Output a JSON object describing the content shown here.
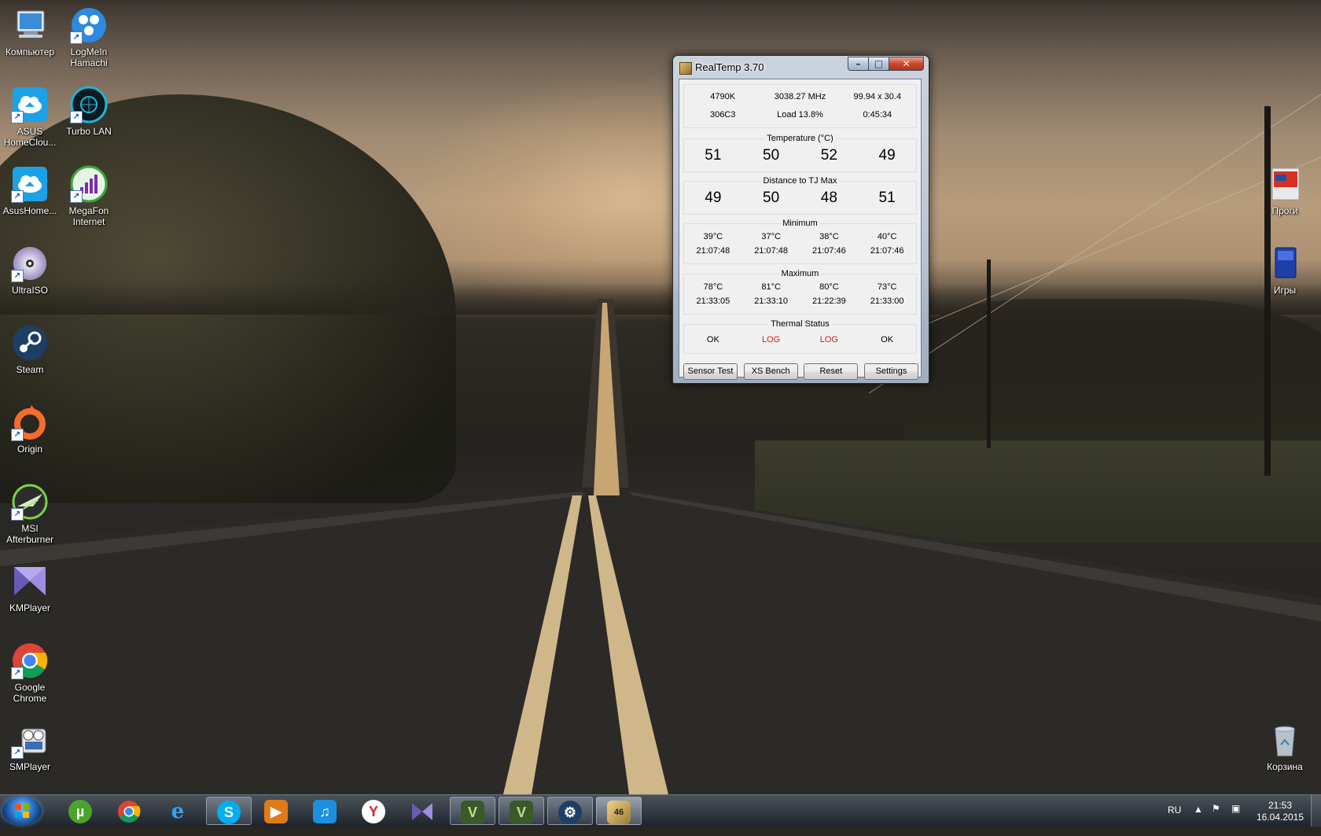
{
  "desktop": {
    "icons_left": [
      {
        "id": "computer",
        "label": "Компьютер",
        "icon": "computer-icon"
      },
      {
        "id": "logmein-hamachi",
        "label": "LogMeIn Hamachi",
        "icon": "hamachi-icon"
      },
      {
        "id": "asus-homecloud",
        "label": "ASUS HomeClou...",
        "icon": "homecloud-icon"
      },
      {
        "id": "turbo-lan",
        "label": "Turbo LAN",
        "icon": "turbo-lan-icon"
      },
      {
        "id": "asushome",
        "label": "AsusHome...",
        "icon": "homecloud-icon"
      },
      {
        "id": "megafon-internet",
        "label": "MegaFon Internet",
        "icon": "megafon-icon"
      },
      {
        "id": "ultraiso",
        "label": "UltraISO",
        "icon": "disc-icon"
      },
      {
        "id": "steam",
        "label": "Steam",
        "icon": "steam-icon"
      },
      {
        "id": "origin",
        "label": "Origin",
        "icon": "origin-icon"
      },
      {
        "id": "msi-afterburner",
        "label": "MSI Afterburner",
        "icon": "afterburner-icon"
      },
      {
        "id": "kmplayer",
        "label": "KMPlayer",
        "icon": "kmplayer-icon"
      },
      {
        "id": "google-chrome",
        "label": "Google Chrome",
        "icon": "chrome-icon"
      },
      {
        "id": "smplayer",
        "label": "SMPlayer",
        "icon": "smplayer-icon"
      }
    ],
    "icons_right": [
      {
        "id": "progi",
        "label": "Проги",
        "icon": "folder-icon"
      },
      {
        "id": "igry",
        "label": "Игры",
        "icon": "folder-icon"
      },
      {
        "id": "recycle-bin",
        "label": "Корзина",
        "icon": "recycle-bin-icon"
      }
    ]
  },
  "window": {
    "title": "RealTemp 3.70",
    "info": {
      "row1": [
        "4790K",
        "3038.27 MHz",
        "99.94 x 30.4"
      ],
      "row2": [
        "306C3",
        "Load  13.8%",
        "0:45:34"
      ]
    },
    "temperature": {
      "title": "Temperature (°C)",
      "values": [
        "51",
        "50",
        "52",
        "49"
      ]
    },
    "distance": {
      "title": "Distance to TJ Max",
      "values": [
        "49",
        "50",
        "48",
        "51"
      ]
    },
    "minimum": {
      "title": "Minimum",
      "temps": [
        "39°C",
        "37°C",
        "38°C",
        "40°C"
      ],
      "times": [
        "21:07:48",
        "21:07:48",
        "21:07:46",
        "21:07:46"
      ]
    },
    "maximum": {
      "title": "Maximum",
      "temps": [
        "78°C",
        "81°C",
        "80°C",
        "73°C"
      ],
      "times": [
        "21:33:05",
        "21:33:10",
        "21:22:39",
        "21:33:00"
      ]
    },
    "thermal": {
      "title": "Thermal Status",
      "values": [
        "OK",
        "LOG",
        "LOG",
        "OK"
      ]
    },
    "buttons": {
      "sensor_test": "Sensor Test",
      "xs_bench": "XS Bench",
      "reset": "Reset",
      "settings": "Settings"
    }
  },
  "taskbar": {
    "pinned": [
      "utorrent-icon",
      "chrome-icon",
      "internet-explorer-icon",
      "skype-icon",
      "media-player-icon",
      "itunes-icon",
      "yandex-browser-icon",
      "kmplayer-icon",
      "gta-v-icon",
      "gta-v-icon",
      "steam-icon",
      "realtemp-icon"
    ],
    "tray": {
      "language": "RU",
      "time": "21:53",
      "date": "16.04.2015"
    }
  },
  "colors": {
    "accent_red": "#d41a1a",
    "window_frame": "#aabbd0"
  }
}
